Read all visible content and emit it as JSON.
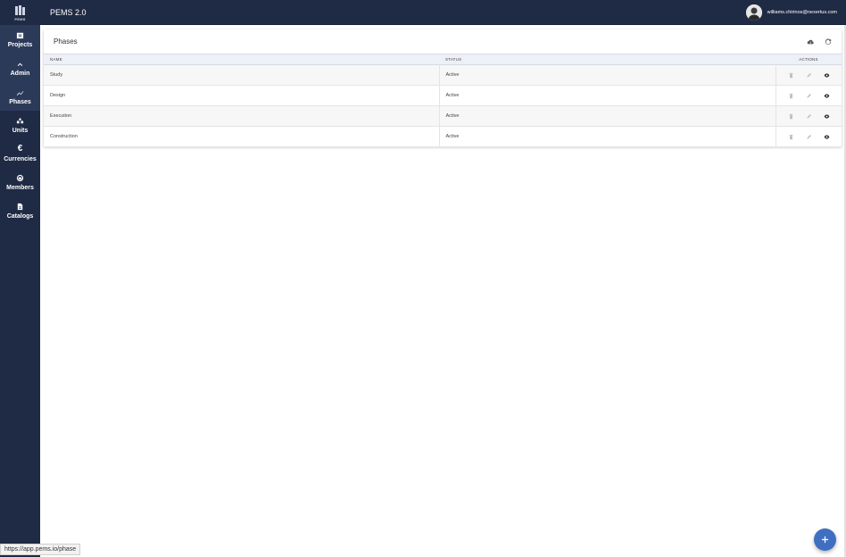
{
  "app": {
    "logo_text": "PEMS",
    "title": "PEMS 2.0",
    "user_email": "williams.chirinos@nexertus.com"
  },
  "sidebar": {
    "items": [
      {
        "label": "Projects",
        "icon": "briefcase-icon",
        "active": true
      },
      {
        "label": "Admin",
        "icon": "chevron-up-icon",
        "active": true
      },
      {
        "label": "Phases",
        "icon": "trend-icon",
        "active": true
      },
      {
        "label": "Units",
        "icon": "shapes-icon",
        "active": false
      },
      {
        "label": "Currencies",
        "icon": "euro-icon",
        "active": false
      },
      {
        "label": "Members",
        "icon": "members-icon",
        "active": false
      },
      {
        "label": "Catalogs",
        "icon": "document-icon",
        "active": false
      }
    ]
  },
  "page": {
    "title": "Phases",
    "actions": [
      "cloud-download-icon",
      "refresh-icon"
    ]
  },
  "table": {
    "columns": [
      "NAME",
      "STATUS",
      "ACTIONS"
    ],
    "rows": [
      {
        "name": "Study",
        "status": "Active"
      },
      {
        "name": "Design",
        "status": "Active"
      },
      {
        "name": "Execution",
        "status": "Active"
      },
      {
        "name": "Construction",
        "status": "Active"
      }
    ]
  },
  "statusbar": {
    "url": "https://app.pems.io/phase"
  },
  "colors": {
    "sidebar": "#1f2a44",
    "topbar": "#1f2a44",
    "fab": "#3f6fc0",
    "table_header": "#eef0f8"
  }
}
